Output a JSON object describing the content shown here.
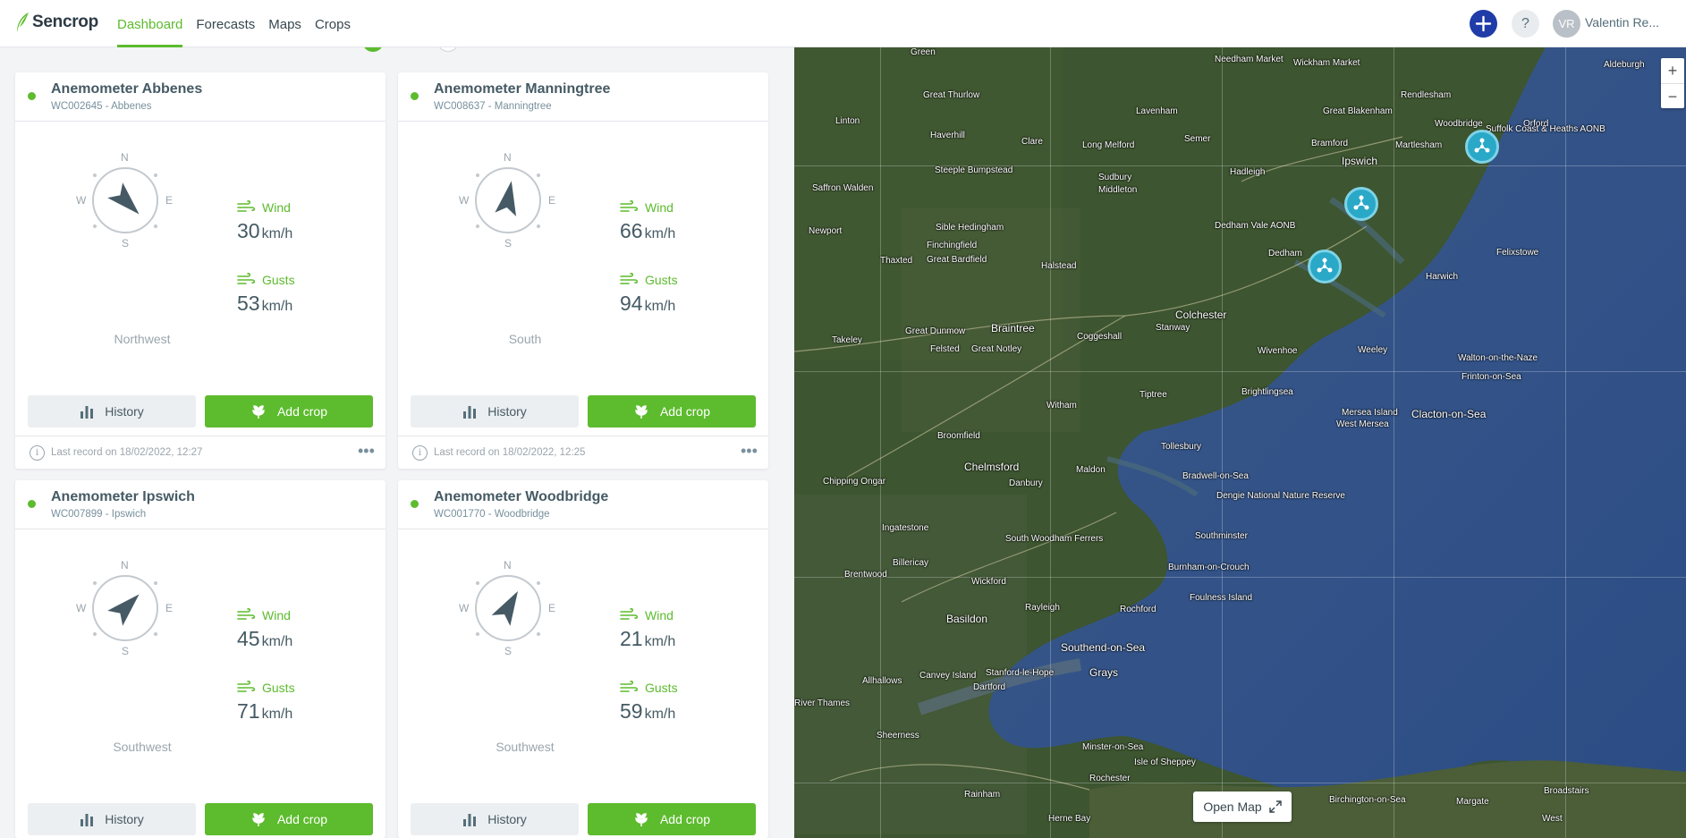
{
  "app": {
    "logo_text": "Sencrop",
    "brand_green": "#5dbb2e",
    "accent_blue": "#1f3ca8"
  },
  "nav": {
    "items": [
      "Dashboard",
      "Forecasts",
      "Maps",
      "Crops"
    ],
    "active": "Dashboard"
  },
  "header": {
    "help_label": "?",
    "avatar_initials": "VR",
    "user_name": "Valentin Re..."
  },
  "common": {
    "wind_label": "Wind",
    "gusts_label": "Gusts",
    "unit": "km/h",
    "history_label": "History",
    "add_crop_label": "Add crop",
    "compass": {
      "n": "N",
      "e": "E",
      "s": "S",
      "w": "W"
    }
  },
  "cards": [
    {
      "title": "Anemometer Abbenes",
      "subtitle": "WC002645 - Abbenes",
      "direction": "Northwest",
      "arrow_heading_deg": 135,
      "wind": "30",
      "gusts": "53",
      "last_record": "Last record on 18/02/2022, 12:27"
    },
    {
      "title": "Anemometer Manningtree",
      "subtitle": "WC008637 - Manningtree",
      "direction": "South",
      "arrow_heading_deg": 10,
      "wind": "66",
      "gusts": "94",
      "last_record": "Last record on 18/02/2022, 12:25"
    },
    {
      "title": "Anemometer Ipswich",
      "subtitle": "WC007899 - Ipswich",
      "direction": "Southwest",
      "arrow_heading_deg": 45,
      "wind": "45",
      "gusts": "71",
      "last_record": ""
    },
    {
      "title": "Anemometer Woodbridge",
      "subtitle": "WC001770 - Woodbridge",
      "direction": "Southwest",
      "arrow_heading_deg": 30,
      "wind": "21",
      "gusts": "59",
      "last_record": ""
    }
  ],
  "map": {
    "open_map_label": "Open Map",
    "zoom_in": "+",
    "zoom_out": "−",
    "labels": [
      "Needham Market",
      "Wickham Market",
      "Aldeburgh",
      "Rendlesham",
      "Green",
      "Great Thurlow",
      "Lavenham",
      "Great Blakenham",
      "Linton",
      "Haverhill",
      "Clare",
      "Long Melford",
      "Semer",
      "Bramford",
      "Woodbridge",
      "Martlesham",
      "Orford",
      "Suffolk Coast & Heaths AONB",
      "Ipswich",
      "Steeple Bumpstead",
      "Sudbury",
      "Hadleigh",
      "Saffron Walden",
      "Middleton",
      "Sible Hedingham",
      "Newport",
      "Dedham Vale AONB",
      "Felixstowe",
      "Finchingfield",
      "Great Bardfield",
      "Thaxted",
      "Halstead",
      "Dedham",
      "Harwich",
      "Colchester",
      "Braintree",
      "Great Dunmow",
      "Coggeshall",
      "Stanway",
      "Takeley",
      "Felsted",
      "Great Notley",
      "Wivenhoe",
      "Weeley",
      "Walton-on-the-Naze",
      "Frinton-on-Sea",
      "Tiptree",
      "Brightlingsea",
      "Witham",
      "Mersea Island",
      "West Mersea",
      "Clacton-on-Sea",
      "Broomfield",
      "Tollesbury",
      "Chelmsford",
      "Maldon",
      "Bradwell-on-Sea",
      "Chipping Ongar",
      "Danbury",
      "Dengie National Nature Reserve",
      "Ingatestone",
      "South Woodham Ferrers",
      "Southminster",
      "Billericay",
      "Brentwood",
      "Wickford",
      "Burnham-on-Crouch",
      "Rayleigh",
      "Rochford",
      "Foulness Island",
      "Basildon",
      "Southend-on-Sea",
      "Stanford-le-Hope",
      "Canvey Island",
      "Grays",
      "Allhallows",
      "Dartford",
      "River Thames",
      "Sheerness",
      "Minster-on-Sea",
      "Isle of Sheppey",
      "Rochester",
      "Rainham",
      "Herne Bay",
      "Birchington-on-Sea",
      "Margate",
      "Broadstairs",
      "West"
    ]
  }
}
